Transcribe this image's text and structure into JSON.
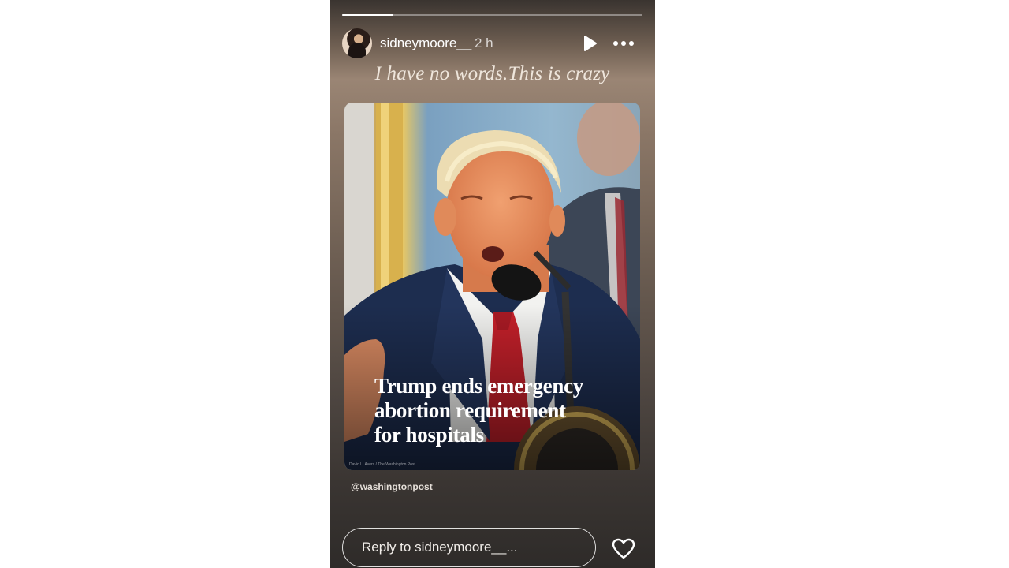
{
  "story": {
    "progress_fraction": 0.17,
    "user": {
      "username": "sidneymoore__",
      "time_ago": "2 h"
    },
    "controls": {
      "play_icon": "play-icon",
      "more_icon": "more-dots-icon"
    },
    "caption": "I have no words.This is crazy",
    "shared_post": {
      "headline": "Trump ends emergency\nabortion requirement\nfor hospitals",
      "photo_credit": "David L. Avers / The Washington Post",
      "source_handle": "@washingtonpost"
    },
    "reply": {
      "placeholder": "Reply to sidneymoore__..."
    },
    "like_icon": "heart-icon"
  }
}
